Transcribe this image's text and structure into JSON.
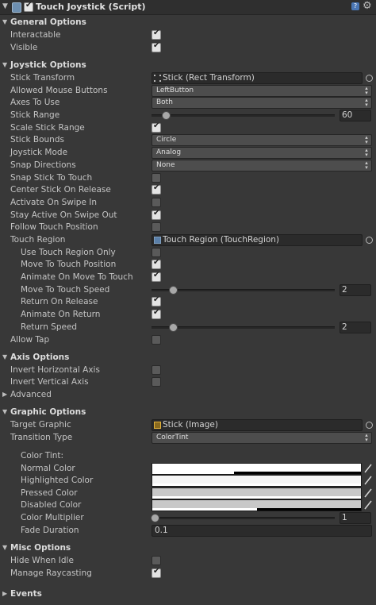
{
  "header": {
    "title": "Touch Joystick (Script)"
  },
  "sections": {
    "general": "General Options",
    "joystick": "Joystick Options",
    "axis": "Axis Options",
    "graphic": "Graphic Options",
    "misc": "Misc Options"
  },
  "general": {
    "interactable": "Interactable",
    "visible": "Visible"
  },
  "joystick": {
    "stick_transform": "Stick Transform",
    "stick_transform_value": "Stick (Rect Transform)",
    "allowed_mouse_buttons": "Allowed Mouse Buttons",
    "allowed_mouse_buttons_value": "LeftButton",
    "axes_to_use": "Axes To Use",
    "axes_to_use_value": "Both",
    "stick_range": "Stick Range",
    "stick_range_value": "60",
    "scale_stick_range": "Scale Stick Range",
    "stick_bounds": "Stick Bounds",
    "stick_bounds_value": "Circle",
    "joystick_mode": "Joystick Mode",
    "joystick_mode_value": "Analog",
    "snap_directions": "Snap Directions",
    "snap_directions_value": "None",
    "snap_stick_to_touch": "Snap Stick To Touch",
    "center_stick_on_release": "Center Stick On Release",
    "activate_on_swipe_in": "Activate On Swipe In",
    "stay_active_on_swipe_out": "Stay Active On Swipe Out",
    "follow_touch_position": "Follow Touch Position",
    "touch_region": "Touch Region",
    "touch_region_value": "Touch Region (TouchRegion)",
    "use_touch_region_only": "Use Touch Region Only",
    "move_to_touch_position": "Move To Touch Position",
    "animate_on_move_to_touch": "Animate On Move To Touch",
    "move_to_touch_speed": "Move To Touch Speed",
    "move_to_touch_speed_value": "2",
    "return_on_release": "Return On Release",
    "animate_on_return": "Animate On Return",
    "return_speed": "Return Speed",
    "return_speed_value": "2",
    "allow_tap": "Allow Tap"
  },
  "axis": {
    "invert_horizontal": "Invert Horizontal Axis",
    "invert_vertical": "Invert Vertical Axis",
    "advanced": "Advanced"
  },
  "graphic": {
    "target_graphic": "Target Graphic",
    "target_graphic_value": "Stick (Image)",
    "transition_type": "Transition Type",
    "transition_type_value": "ColorTint",
    "color_tint": "Color Tint:",
    "normal_color": "Normal Color",
    "highlighted_color": "Highlighted Color",
    "pressed_color": "Pressed Color",
    "disabled_color": "Disabled Color",
    "color_multiplier": "Color Multiplier",
    "color_multiplier_value": "1",
    "fade_duration": "Fade Duration",
    "fade_duration_value": "0.1"
  },
  "misc": {
    "hide_when_idle": "Hide When Idle",
    "manage_raycasting": "Manage Raycasting"
  },
  "events": "Events",
  "slider_levels": {
    "stick_range": 0.06,
    "move_to_touch_speed": 0.1,
    "return_speed": 0.1,
    "color_multiplier": 0.0
  },
  "alpha_levels": {
    "normal": 0.39,
    "highlighted": 1.0,
    "pressed": 1.0,
    "disabled": 0.5
  },
  "colors": {
    "background": "#383838",
    "normal": "#ffffff",
    "highlighted": "#f5f5f5",
    "pressed": "#c8c8c8",
    "disabled": "#c8c8c8"
  },
  "icons": [
    "script-icon",
    "help-icon",
    "gear-icon",
    "rect-transform-icon",
    "touch-region-icon",
    "image-icon",
    "eyedropper-icon",
    "object-picker-icon"
  ]
}
